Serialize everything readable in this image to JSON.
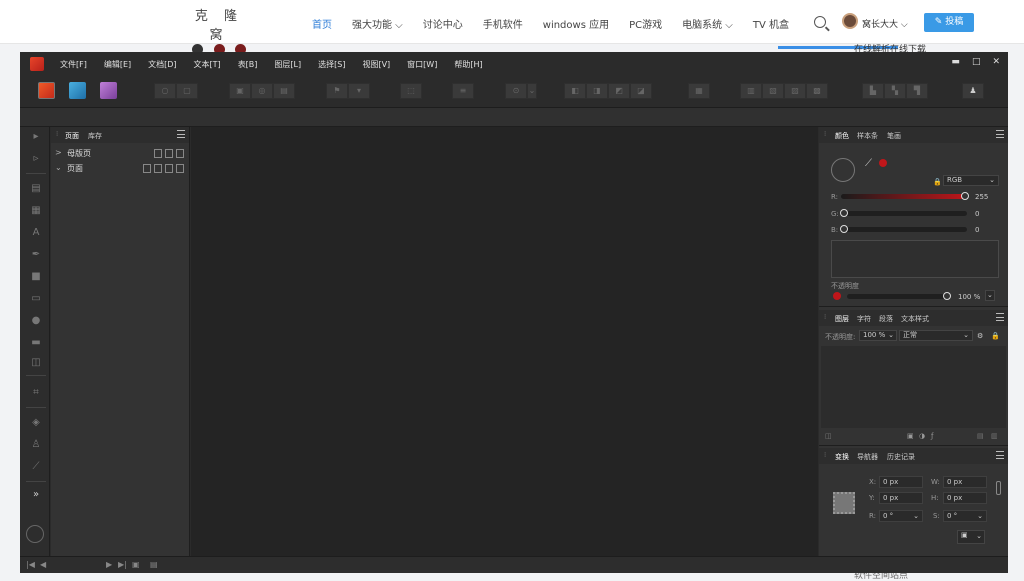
{
  "site": {
    "logo_text": "克 隆 窝",
    "nav": [
      {
        "label": "首页",
        "active": true
      },
      {
        "label": "强大功能 ⌵",
        "active": false
      },
      {
        "label": "讨论中心",
        "active": false
      },
      {
        "label": "手机软件",
        "active": false
      },
      {
        "label": "windows 应用",
        "active": false
      },
      {
        "label": "PC游戏",
        "active": false
      },
      {
        "label": "电脑系统 ⌵",
        "active": false
      },
      {
        "label": "TV 机盒",
        "active": false
      }
    ],
    "username": "窝长大大 ⌵",
    "post_button": "✎ 投稿",
    "peek_top_text": "在线解析在线下载",
    "peek_bottom_text": "软件空间站点"
  },
  "app": {
    "menus": [
      "文件[F]",
      "编辑[E]",
      "文档[D]",
      "文本[T]",
      "表[B]",
      "图层[L]",
      "选择[S]",
      "视图[V]",
      "窗口[W]",
      "帮助[H]"
    ],
    "window_controls": {
      "minimize": "▬",
      "maximize": "□",
      "close": "✕"
    },
    "pages_panel": {
      "tabs": [
        "页面",
        "库存"
      ],
      "rows": [
        {
          "chevron": ">",
          "label": "母版页"
        },
        {
          "chevron": "⌄",
          "label": "页面"
        }
      ]
    },
    "color_panel": {
      "tabs": [
        "颜色",
        "样本条",
        "笔画"
      ],
      "model": "RGB",
      "r_label": "R:",
      "r_value": "255",
      "g_label": "G:",
      "g_value": "0",
      "b_label": "B:",
      "b_value": "0",
      "opacity_label": "不透明度",
      "opacity_value": "100 %",
      "fill_color": "#c0161a"
    },
    "layers_panel": {
      "tabs": [
        "图层",
        "字符",
        "段落",
        "文本样式"
      ],
      "opacity_label": "不透明度:",
      "opacity_value": "100 %",
      "blend_mode": "正常"
    },
    "transform_panel": {
      "tabs": [
        "变换",
        "导航器",
        "历史记录"
      ],
      "x_label": "X:",
      "x_value": "0 px",
      "y_label": "Y:",
      "y_value": "0 px",
      "w_label": "W:",
      "w_value": "0 px",
      "h_label": "H:",
      "h_value": "0 px",
      "r_label": "R:",
      "r_value": "0 °",
      "s_label": "S:",
      "s_value": "0 °"
    },
    "status": {
      "first": "|◀",
      "prev": "◀",
      "next": "▶",
      "last": "▶|"
    }
  }
}
